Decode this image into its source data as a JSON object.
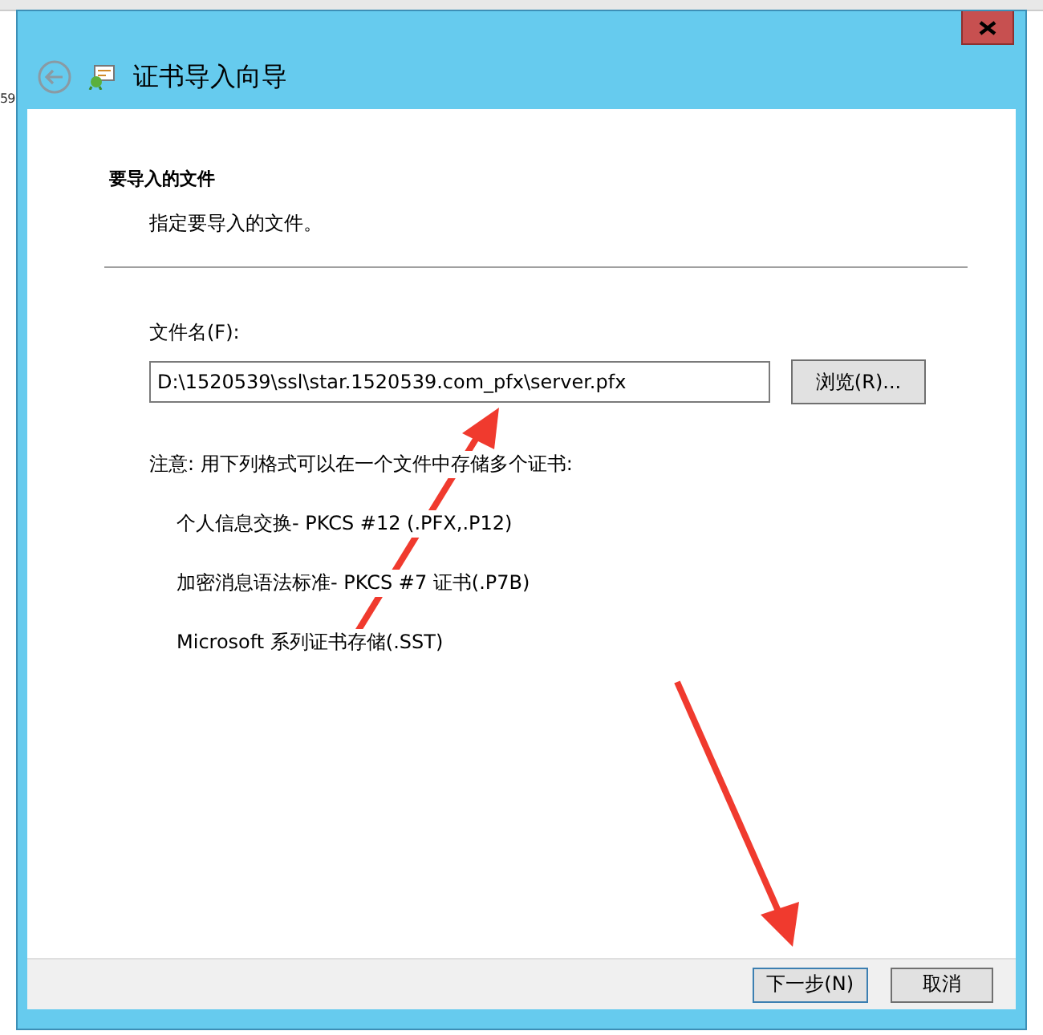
{
  "background": {
    "text": "59"
  },
  "window": {
    "title": "证书导入向导"
  },
  "page": {
    "heading": "要导入的文件",
    "subheading": "指定要导入的文件。"
  },
  "file_field": {
    "label": "文件名(F):",
    "value": "D:\\1520539\\ssl\\star.1520539.com_pfx\\server.pfx"
  },
  "browse_button": "浏览(R)...",
  "note": "注意: 用下列格式可以在一个文件中存储多个证书:",
  "formats": [
    "个人信息交换- PKCS #12 (.PFX,.P12)",
    "加密消息语法标准- PKCS #7 证书(.P7B)",
    "Microsoft 系列证书存储(.SST)"
  ],
  "buttons": [
    {
      "label": "下一步(N)",
      "default": true
    },
    {
      "label": "取消",
      "default": false
    }
  ]
}
